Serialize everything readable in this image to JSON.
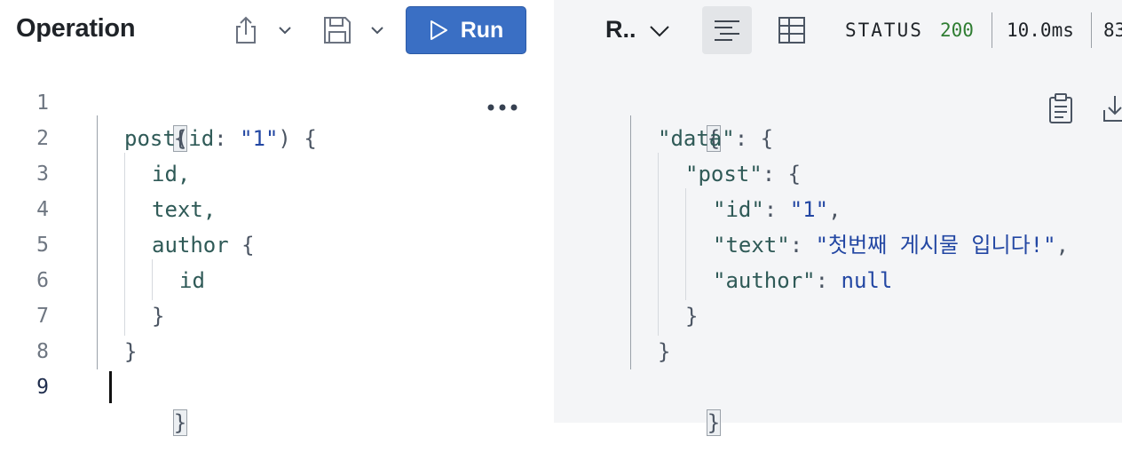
{
  "operation_pane": {
    "title": "Operation",
    "run_label": "Run",
    "line_numbers": [
      "1",
      "2",
      "3",
      "4",
      "5",
      "6",
      "7",
      "8",
      "9"
    ],
    "code": {
      "l1": "{",
      "l2_field": "post",
      "l2_paren_open": "(",
      "l2_arg": "id",
      "l2_colon": ": ",
      "l2_value": "\"1\"",
      "l2_paren_close": ")",
      "l2_brace": " {",
      "l3": "id,",
      "l4": "text,",
      "l5_field": "author",
      "l5_brace": " {",
      "l6": "id",
      "l7": "}",
      "l8": "}",
      "l9": "}"
    }
  },
  "response_pane": {
    "title": "R..",
    "status_label": "STATUS",
    "status_code": "200",
    "duration": "10.0ms",
    "size": "83",
    "json": {
      "l1": "{",
      "l2_key": "\"data\"",
      "l2_rest": ": {",
      "l3_key": "\"post\"",
      "l3_rest": ": {",
      "l4_key": "\"id\"",
      "l4_colon": ": ",
      "l4_value": "\"1\"",
      "l4_comma": ",",
      "l5_key": "\"text\"",
      "l5_colon": ": ",
      "l5_value": "\"첫번째 게시물 입니다!\"",
      "l5_comma": ",",
      "l6_key": "\"author\"",
      "l6_colon": ": ",
      "l6_value": "null",
      "l7": "}",
      "l8": "}",
      "l9": "}"
    }
  },
  "colors": {
    "run_button": "#3a6fc4",
    "status_ok": "#2f7d32",
    "string": "#2347a3",
    "field": "#2f5a57"
  },
  "icons": [
    "share-icon",
    "chevron-down-icon",
    "save-icon",
    "play-icon",
    "more-icon",
    "text-view-icon",
    "table-view-icon",
    "clipboard-icon",
    "download-icon"
  ]
}
